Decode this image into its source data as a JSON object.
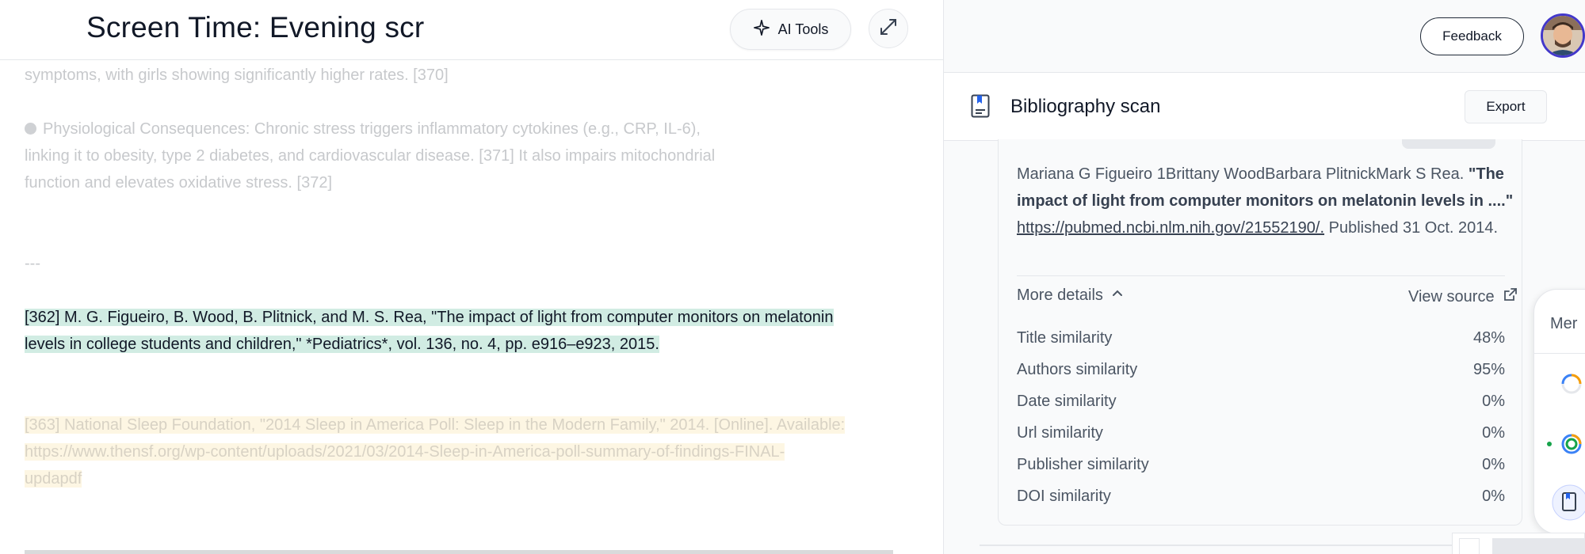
{
  "document": {
    "title": "Screen Time: Evening scr",
    "ai_tools_label": "AI Tools",
    "lines": {
      "l1": "symptoms, with girls showing significantly higher rates. [370]",
      "l2": "Physiological Consequences: Chronic stress triggers inflammatory cytokines (e.g., CRP, IL-6),",
      "l3": "linking it to obesity, type 2 diabetes, and cardiovascular disease. [371] It also impairs mitochondrial",
      "l4": "function and elevates oxidative stress. [372]",
      "separator": "---",
      "ref362_a": "[362] M. G. Figueiro, B. Wood, B. Plitnick, and M. S. Rea, \"The impact of light from computer monitors on melatonin",
      "ref362_b": "levels in college students and children,\" *Pediatrics*, vol. 136, no. 4, pp. e916–e923, 2015.",
      "ref363_a": "[363] National Sleep Foundation, \"2014 Sleep in America Poll: Sleep in the Modern Family,\" 2014. [Online]. Available:",
      "ref363_b": "https://www.thensf.org/wp-content/uploads/2021/03/2014-Sleep-in-America-poll-summary-of-findings-FINAL-",
      "ref363_c": "updapdf"
    }
  },
  "header": {
    "feedback_label": "Feedback"
  },
  "bibliography": {
    "title": "Bibliography scan",
    "export_label": "Export",
    "citation": {
      "authors": "Mariana G Figueiro 1Brittany WoodBarbara PlitnickMark S Rea.",
      "title_quoted": "\"The impact of light from computer monitors on melatonin levels in ....\"",
      "url": "https://pubmed.ncbi.nlm.nih.gov/21552190/.",
      "published": "Published 31 Oct. 2014."
    },
    "more_details_label": "More details",
    "view_source_label": "View source",
    "similarities": [
      {
        "label": "Title similarity",
        "value": "48%"
      },
      {
        "label": "Authors similarity",
        "value": "95%"
      },
      {
        "label": "Date similarity",
        "value": "0%"
      },
      {
        "label": "Url similarity",
        "value": "0%"
      },
      {
        "label": "Publisher similarity",
        "value": "0%"
      },
      {
        "label": "DOI similarity",
        "value": "0%"
      }
    ]
  },
  "side_menu": {
    "label_partial": "Mer"
  },
  "colors": {
    "highlight_green": "#d1ece3",
    "highlight_yellow": "#fdf6e3",
    "avatar_ring": "#4338ca"
  }
}
